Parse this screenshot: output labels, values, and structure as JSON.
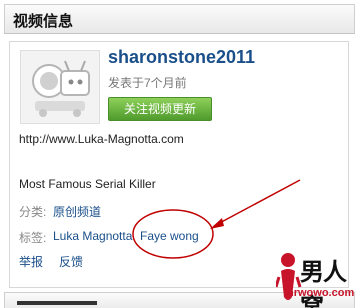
{
  "panel": {
    "title": "视频信息"
  },
  "channel": {
    "name": "sharonstone2011",
    "published": "发表于7个月前",
    "follow_label": "关注视频更新"
  },
  "video": {
    "url": "http://www.Luka-Magnotta.com",
    "description": "Most Famous Serial Killer"
  },
  "meta": {
    "category_label": "分类:",
    "category_value": "原创频道",
    "tags_label": "标签:",
    "tags": [
      "Luka Magnotta",
      "Faye wong"
    ]
  },
  "actions": {
    "report": "举报",
    "feedback": "反馈"
  },
  "watermark": {
    "text": "男人窝",
    "url": "nrwowo.com"
  },
  "colors": {
    "link": "#1a4f8a",
    "button": "#5ea934",
    "annotation": "#c00000"
  }
}
